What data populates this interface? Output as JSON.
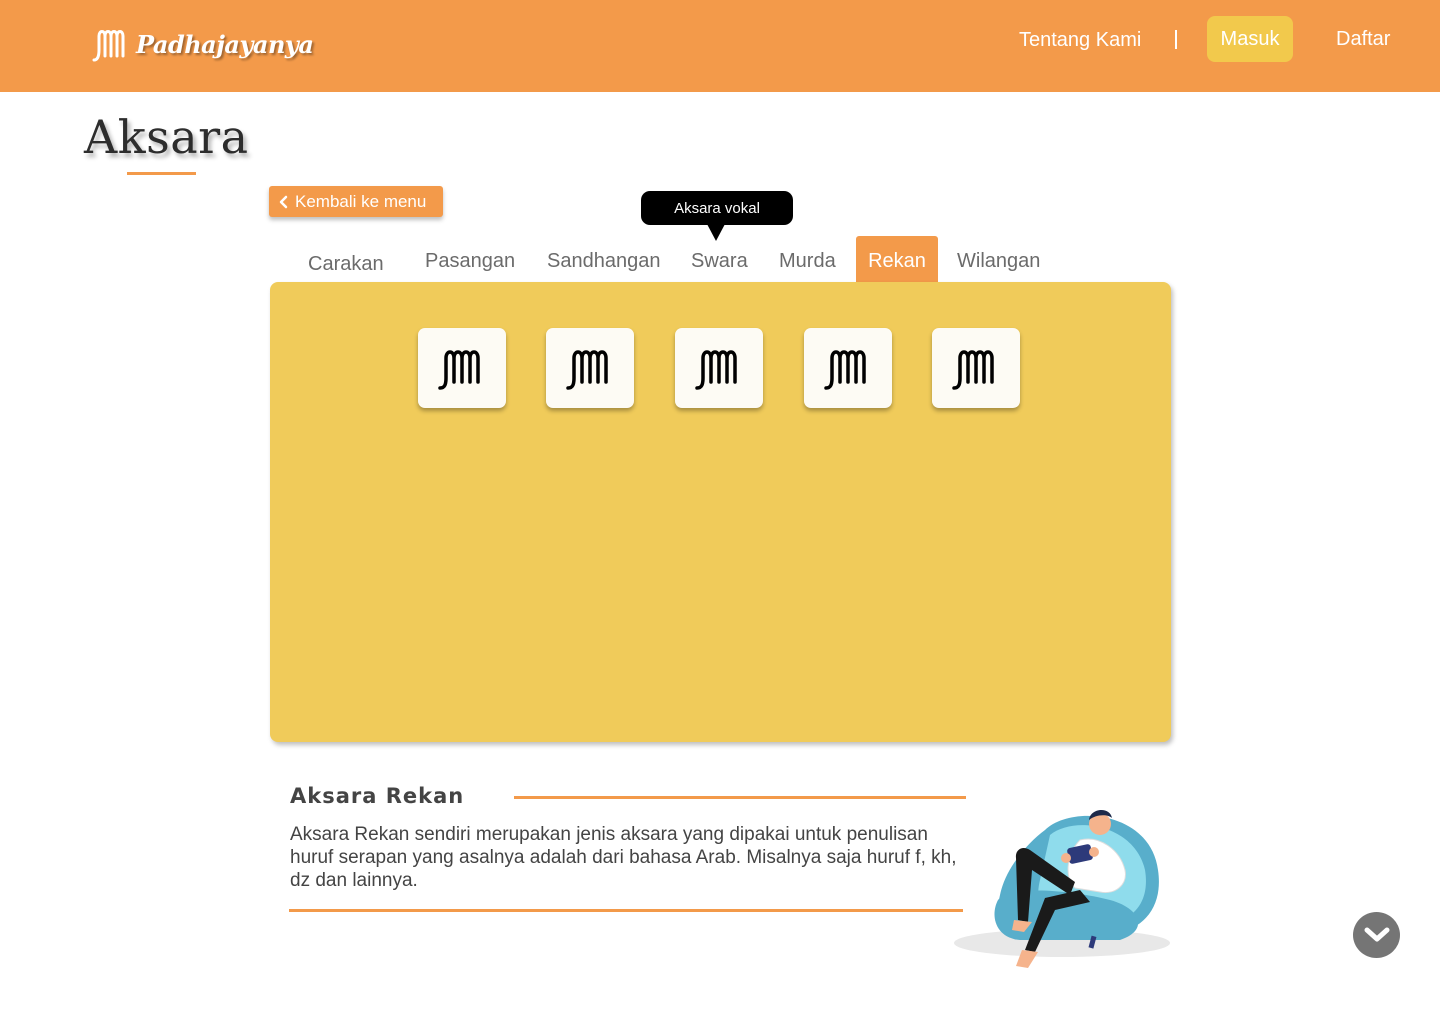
{
  "header": {
    "brand": "Padhajayanya",
    "nav": {
      "about": "Tentang Kami",
      "login": "Masuk",
      "register": "Daftar"
    }
  },
  "page": {
    "title": "Aksara",
    "back_button": "Kembali ke menu"
  },
  "tooltip": "Aksara vokal",
  "tabs": [
    {
      "label": "Carakan",
      "active": false
    },
    {
      "label": "Pasangan",
      "active": false
    },
    {
      "label": "Sandhangan",
      "active": false
    },
    {
      "label": "Swara",
      "active": false
    },
    {
      "label": "Murda",
      "active": false
    },
    {
      "label": "Rekan",
      "active": true
    },
    {
      "label": "Wilangan",
      "active": false
    }
  ],
  "panel": {
    "cards": [
      "javanese-glyph",
      "javanese-glyph",
      "javanese-glyph",
      "javanese-glyph",
      "javanese-glyph"
    ]
  },
  "description": {
    "title": "Aksara Rekan",
    "body": "Aksara Rekan sendiri merupakan jenis aksara yang dipakai untuk penulisan huruf serapan yang asalnya adalah dari bahasa Arab. Misalnya saja huruf f, kh, dz dan lainnya."
  },
  "colors": {
    "primary": "#F39A4A",
    "accent": "#F2C94C",
    "panel": "#F0CB5A"
  },
  "icons": {
    "scroll": "chevron-down-icon",
    "back": "chevron-left-icon"
  }
}
